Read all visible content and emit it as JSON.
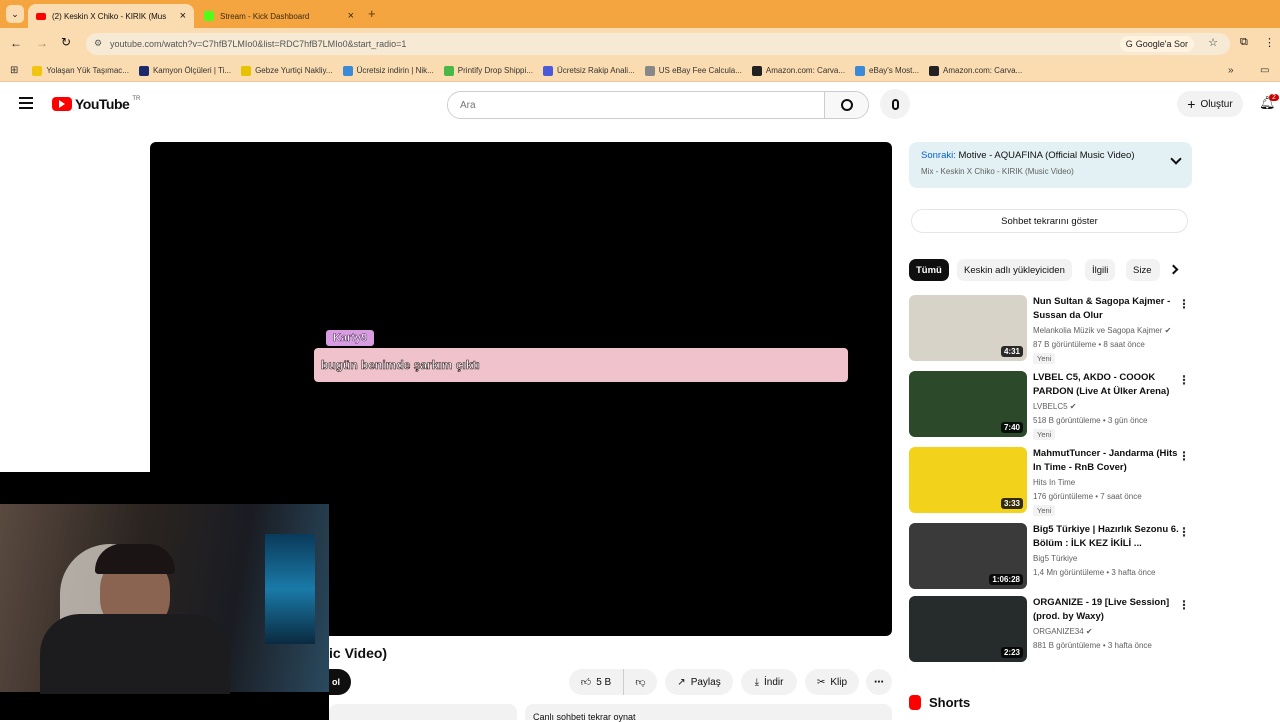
{
  "browser": {
    "tabs": [
      {
        "title": "(2) Keskin X Chiko - KIRIK (Mus"
      },
      {
        "title": "Stream - Kick Dashboard"
      }
    ],
    "url": "youtube.com/watch?v=C7hfB7LMIo0&list=RDC7hfB7LMIo0&start_radio=1",
    "google_btn": "Google'a Sor",
    "bookmarks": [
      {
        "label": "Yolaşan Yük Taşımac...",
        "color": "#f1c40f"
      },
      {
        "label": "Kamyon Ölçüleri | Ti...",
        "color": "#1a2a6a"
      },
      {
        "label": "Gebze Yurtiçi Nakliy...",
        "color": "#e6c200"
      },
      {
        "label": "Ücretsiz indirin | Nik...",
        "color": "#3a8ad8"
      },
      {
        "label": "Printify Drop Shippi...",
        "color": "#49b849"
      },
      {
        "label": "Ücretsiz Rakip Anali...",
        "color": "#4a5ad8"
      },
      {
        "label": "US eBay Fee Calcula...",
        "color": "#888888"
      },
      {
        "label": "Amazon.com: Carva...",
        "color": "#222222"
      },
      {
        "label": "eBay's Most...",
        "color": "#3a8ad8"
      },
      {
        "label": "Amazon.com: Carva...",
        "color": "#222222"
      }
    ]
  },
  "youtube": {
    "logo": "YouTube",
    "region": "TR",
    "search_placeholder": "Ara",
    "create_label": "Oluştur",
    "notif_count": "2"
  },
  "stream": {
    "chat_user": "Karty9",
    "chat_message": "bugün benimde şarkım çıktı"
  },
  "below_video": {
    "title_fragment": "ic Video)",
    "subscribe_fragment": "ol",
    "likes": "5 B",
    "share": "Paylaş",
    "download": "İndir",
    "clip": "Klip",
    "chat_replay": "Canlı sohbeti tekrar oynat"
  },
  "sidebar": {
    "next_prefix": "Sonraki:",
    "next_title": "Motive - AQUAFINA (Official Music Video)",
    "mix_subtitle": "Mix - Keskin X Chiko - KIRIK (Music Video)",
    "chat_replay_btn": "Sohbet tekrarını göster",
    "chips": [
      "Tümü",
      "Keskin adlı yükleyiciden",
      "İlgili",
      "Size"
    ],
    "videos": [
      {
        "title": "Nun Sultan & Sagopa Kajmer - Sussan da Olur",
        "channel": "Melankolia Müzik ve Sagopa Kajmer",
        "meta": "87 B görüntüleme • 8 saat önce",
        "duration": "4:31",
        "badge": "Yeni",
        "verified": true,
        "thumb": "#d8d3c8"
      },
      {
        "title": "LVBEL C5, AKDO - COOOK PARDON (Live At Ülker Arena)",
        "channel": "LVBELC5",
        "meta": "518 B görüntüleme • 3 gün önce",
        "duration": "7:40",
        "badge": "Yeni",
        "verified": true,
        "thumb": "#2c4a2a"
      },
      {
        "title": "MahmutTuncer - Jandarma (Hits In Time - RnB Cover)",
        "channel": "Hits In Time",
        "meta": "176 görüntüleme • 7 saat önce",
        "duration": "3:33",
        "badge": "Yeni",
        "verified": false,
        "thumb": "#f3d21c"
      },
      {
        "title": "Big5 Türkiye | Hazırlık Sezonu 6. Bölüm : İLK KEZ İKİLİ ...",
        "channel": "Big5 Türkiye",
        "meta": "1,4 Mn görüntüleme • 3 hafta önce",
        "duration": "1:06:28",
        "badge": "",
        "verified": false,
        "thumb": "#3a3a3a"
      },
      {
        "title": "ORGANIZE - 19 [Live Session] (prod. by Waxy)",
        "channel": "ORGANIZE34",
        "meta": "881 B görüntüleme • 3 hafta önce",
        "duration": "2:23",
        "badge": "",
        "verified": true,
        "thumb": "#262b2c"
      }
    ],
    "shorts_label": "Shorts"
  }
}
